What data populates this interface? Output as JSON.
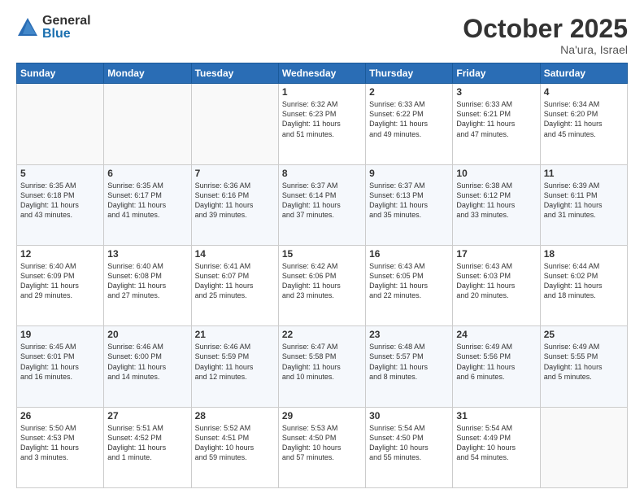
{
  "logo": {
    "general": "General",
    "blue": "Blue"
  },
  "header": {
    "month": "October 2025",
    "location": "Na'ura, Israel"
  },
  "weekdays": [
    "Sunday",
    "Monday",
    "Tuesday",
    "Wednesday",
    "Thursday",
    "Friday",
    "Saturday"
  ],
  "weeks": [
    [
      {
        "day": "",
        "info": ""
      },
      {
        "day": "",
        "info": ""
      },
      {
        "day": "",
        "info": ""
      },
      {
        "day": "1",
        "info": "Sunrise: 6:32 AM\nSunset: 6:23 PM\nDaylight: 11 hours\nand 51 minutes."
      },
      {
        "day": "2",
        "info": "Sunrise: 6:33 AM\nSunset: 6:22 PM\nDaylight: 11 hours\nand 49 minutes."
      },
      {
        "day": "3",
        "info": "Sunrise: 6:33 AM\nSunset: 6:21 PM\nDaylight: 11 hours\nand 47 minutes."
      },
      {
        "day": "4",
        "info": "Sunrise: 6:34 AM\nSunset: 6:20 PM\nDaylight: 11 hours\nand 45 minutes."
      }
    ],
    [
      {
        "day": "5",
        "info": "Sunrise: 6:35 AM\nSunset: 6:18 PM\nDaylight: 11 hours\nand 43 minutes."
      },
      {
        "day": "6",
        "info": "Sunrise: 6:35 AM\nSunset: 6:17 PM\nDaylight: 11 hours\nand 41 minutes."
      },
      {
        "day": "7",
        "info": "Sunrise: 6:36 AM\nSunset: 6:16 PM\nDaylight: 11 hours\nand 39 minutes."
      },
      {
        "day": "8",
        "info": "Sunrise: 6:37 AM\nSunset: 6:14 PM\nDaylight: 11 hours\nand 37 minutes."
      },
      {
        "day": "9",
        "info": "Sunrise: 6:37 AM\nSunset: 6:13 PM\nDaylight: 11 hours\nand 35 minutes."
      },
      {
        "day": "10",
        "info": "Sunrise: 6:38 AM\nSunset: 6:12 PM\nDaylight: 11 hours\nand 33 minutes."
      },
      {
        "day": "11",
        "info": "Sunrise: 6:39 AM\nSunset: 6:11 PM\nDaylight: 11 hours\nand 31 minutes."
      }
    ],
    [
      {
        "day": "12",
        "info": "Sunrise: 6:40 AM\nSunset: 6:09 PM\nDaylight: 11 hours\nand 29 minutes."
      },
      {
        "day": "13",
        "info": "Sunrise: 6:40 AM\nSunset: 6:08 PM\nDaylight: 11 hours\nand 27 minutes."
      },
      {
        "day": "14",
        "info": "Sunrise: 6:41 AM\nSunset: 6:07 PM\nDaylight: 11 hours\nand 25 minutes."
      },
      {
        "day": "15",
        "info": "Sunrise: 6:42 AM\nSunset: 6:06 PM\nDaylight: 11 hours\nand 23 minutes."
      },
      {
        "day": "16",
        "info": "Sunrise: 6:43 AM\nSunset: 6:05 PM\nDaylight: 11 hours\nand 22 minutes."
      },
      {
        "day": "17",
        "info": "Sunrise: 6:43 AM\nSunset: 6:03 PM\nDaylight: 11 hours\nand 20 minutes."
      },
      {
        "day": "18",
        "info": "Sunrise: 6:44 AM\nSunset: 6:02 PM\nDaylight: 11 hours\nand 18 minutes."
      }
    ],
    [
      {
        "day": "19",
        "info": "Sunrise: 6:45 AM\nSunset: 6:01 PM\nDaylight: 11 hours\nand 16 minutes."
      },
      {
        "day": "20",
        "info": "Sunrise: 6:46 AM\nSunset: 6:00 PM\nDaylight: 11 hours\nand 14 minutes."
      },
      {
        "day": "21",
        "info": "Sunrise: 6:46 AM\nSunset: 5:59 PM\nDaylight: 11 hours\nand 12 minutes."
      },
      {
        "day": "22",
        "info": "Sunrise: 6:47 AM\nSunset: 5:58 PM\nDaylight: 11 hours\nand 10 minutes."
      },
      {
        "day": "23",
        "info": "Sunrise: 6:48 AM\nSunset: 5:57 PM\nDaylight: 11 hours\nand 8 minutes."
      },
      {
        "day": "24",
        "info": "Sunrise: 6:49 AM\nSunset: 5:56 PM\nDaylight: 11 hours\nand 6 minutes."
      },
      {
        "day": "25",
        "info": "Sunrise: 6:49 AM\nSunset: 5:55 PM\nDaylight: 11 hours\nand 5 minutes."
      }
    ],
    [
      {
        "day": "26",
        "info": "Sunrise: 5:50 AM\nSunset: 4:53 PM\nDaylight: 11 hours\nand 3 minutes."
      },
      {
        "day": "27",
        "info": "Sunrise: 5:51 AM\nSunset: 4:52 PM\nDaylight: 11 hours\nand 1 minute."
      },
      {
        "day": "28",
        "info": "Sunrise: 5:52 AM\nSunset: 4:51 PM\nDaylight: 10 hours\nand 59 minutes."
      },
      {
        "day": "29",
        "info": "Sunrise: 5:53 AM\nSunset: 4:50 PM\nDaylight: 10 hours\nand 57 minutes."
      },
      {
        "day": "30",
        "info": "Sunrise: 5:54 AM\nSunset: 4:50 PM\nDaylight: 10 hours\nand 55 minutes."
      },
      {
        "day": "31",
        "info": "Sunrise: 5:54 AM\nSunset: 4:49 PM\nDaylight: 10 hours\nand 54 minutes."
      },
      {
        "day": "",
        "info": ""
      }
    ]
  ]
}
